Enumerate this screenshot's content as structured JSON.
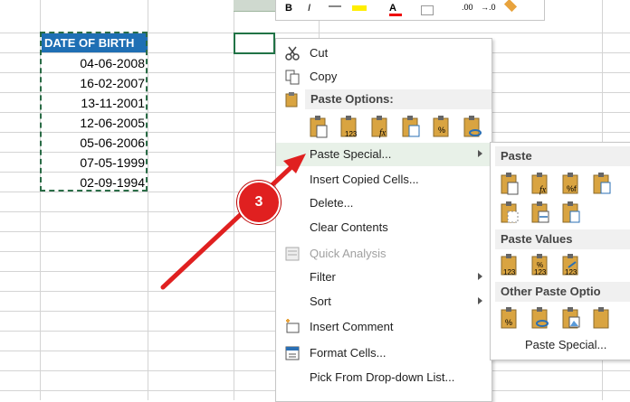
{
  "sheet": {
    "header": "DATE OF BIRTH",
    "dates": [
      "04-06-2008",
      "16-02-2007",
      "13-11-2001",
      "12-06-2005",
      "05-06-2006",
      "07-05-1999",
      "02-09-1994"
    ]
  },
  "mini_toolbar": {
    "bold": "B",
    "italic": "I",
    "font_color": "A",
    "dec_more": ".00",
    "dec_less": "→.0"
  },
  "context_menu": {
    "cut": "Cut",
    "copy": "Copy",
    "paste_options_title": "Paste Options:",
    "paste_special": "Paste Special...",
    "insert_copied_cells": "Insert Copied Cells...",
    "delete": "Delete...",
    "clear_contents": "Clear Contents",
    "quick_analysis": "Quick Analysis",
    "filter": "Filter",
    "sort": "Sort",
    "insert_comment": "Insert Comment",
    "format_cells": "Format Cells...",
    "pick_from_list": "Pick From Drop-down List..."
  },
  "submenu": {
    "paste_title": "Paste",
    "paste_values_title": "Paste Values",
    "other_paste_title": "Other Paste Optio",
    "paste_special_link": "Paste Special..."
  },
  "annotation": {
    "step": "3"
  },
  "colors": {
    "header_bg": "#1f6fb4",
    "marquee": "#2a6c46",
    "arrow": "#e02020",
    "highlight": "#e8f1e8"
  },
  "icons": [
    "cut-icon",
    "copy-icon",
    "paste-icon",
    "quick-analysis-icon",
    "insert-comment-icon",
    "format-cells-icon",
    "submenu-arrow-icon",
    "red-arrow"
  ]
}
